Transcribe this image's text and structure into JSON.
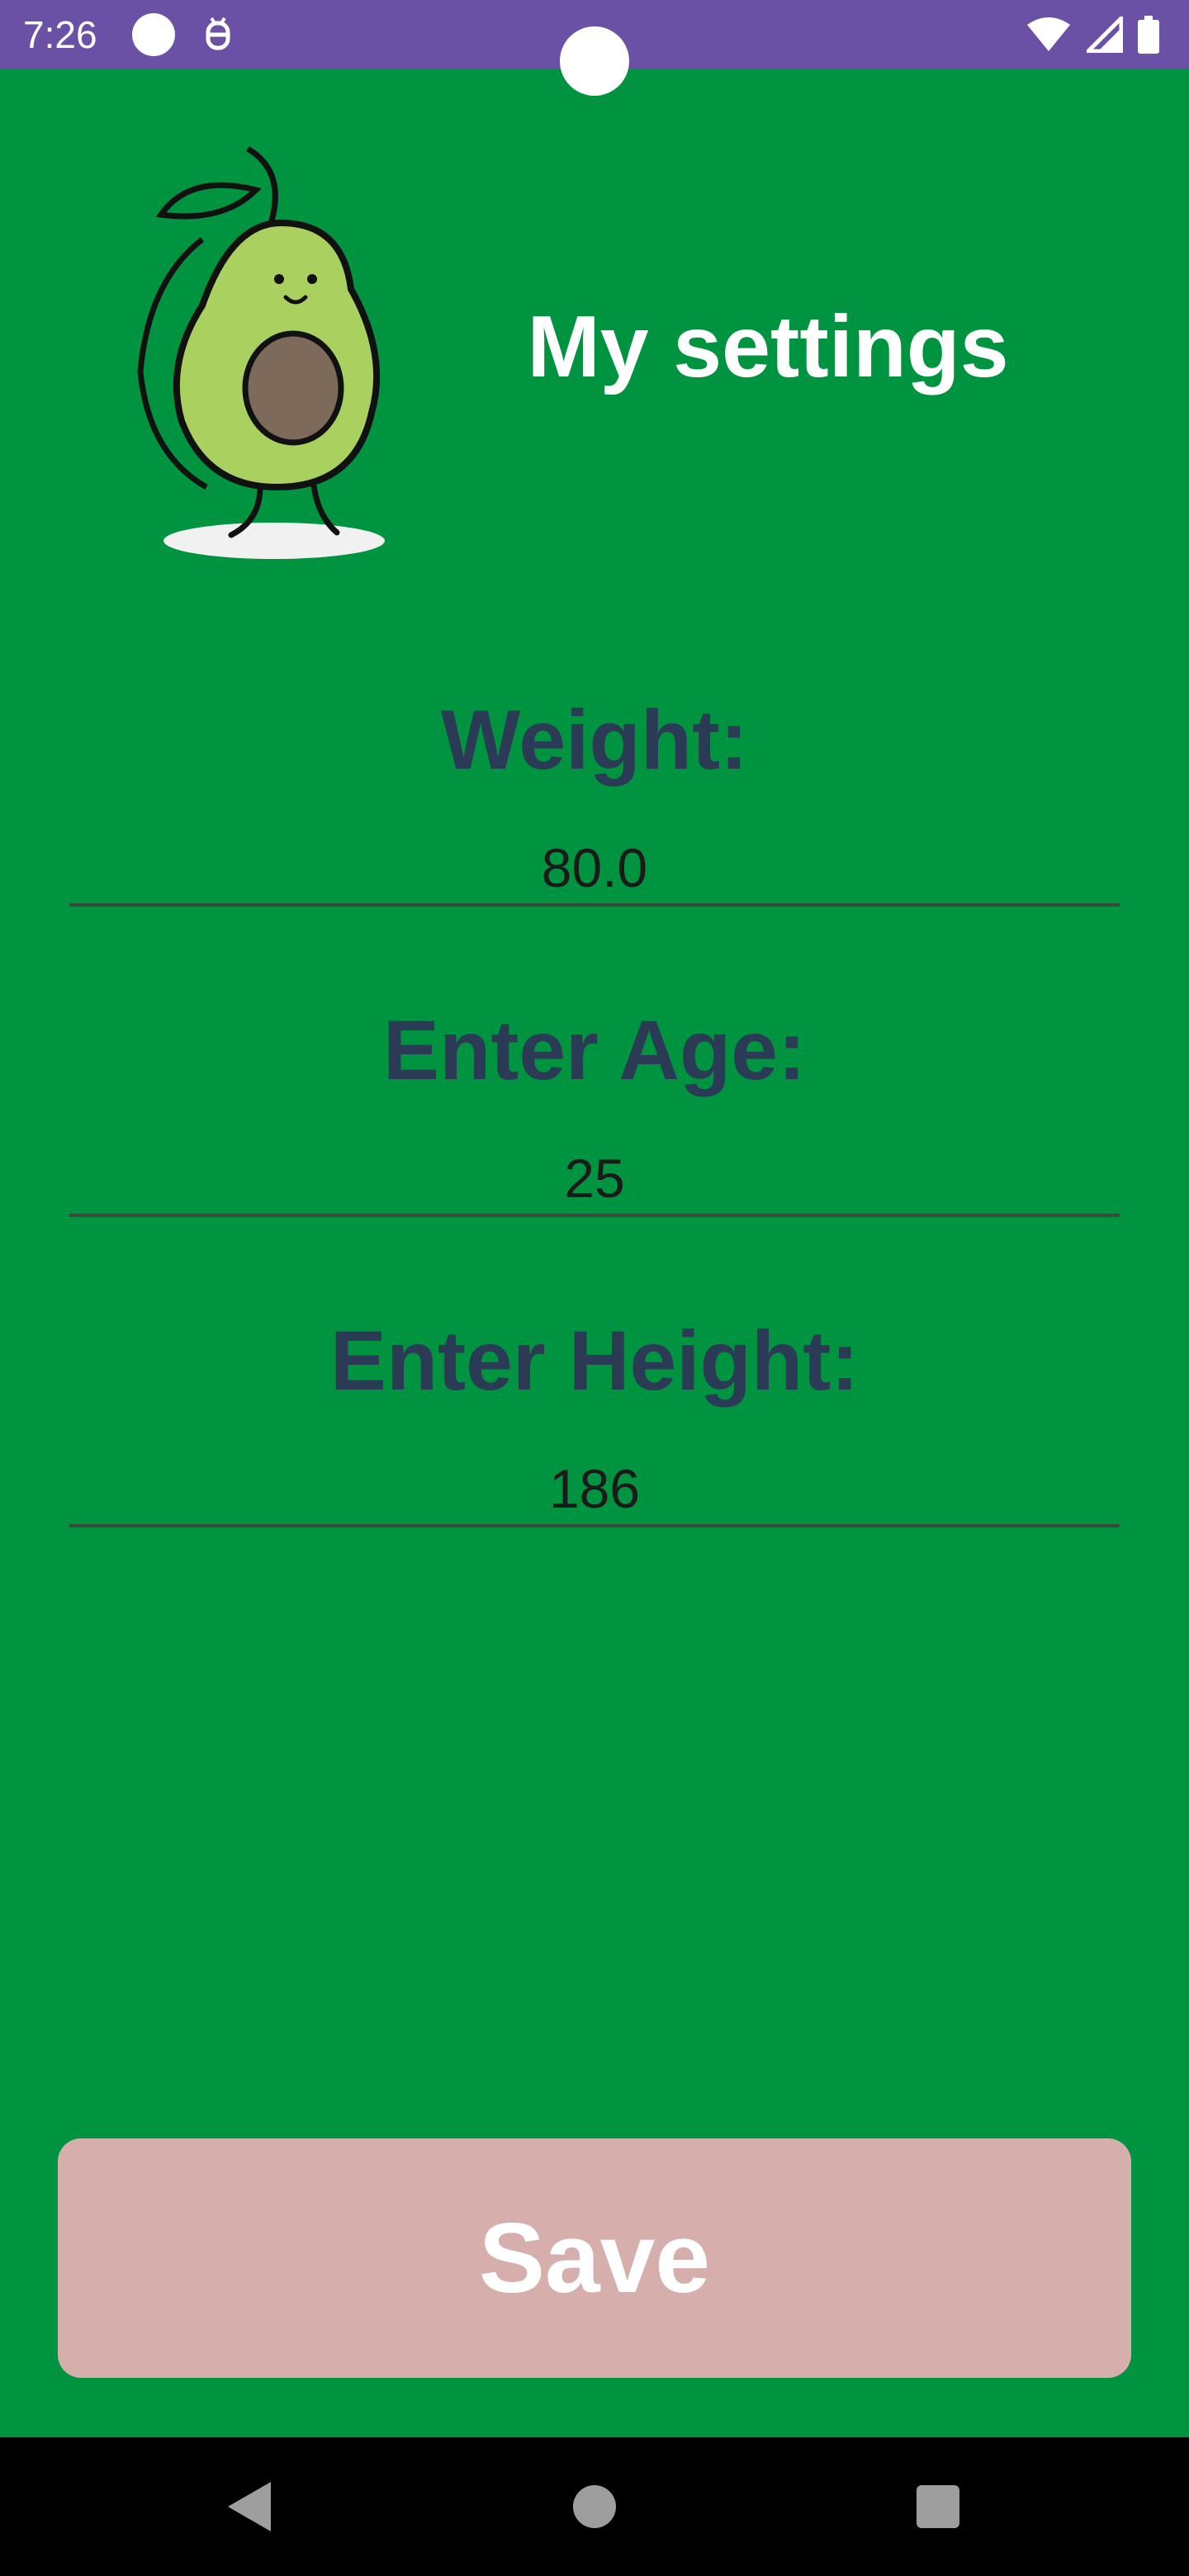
{
  "status_bar": {
    "time": "7:26",
    "icons": [
      "circle-icon",
      "usb-debug-icon",
      "wifi-icon",
      "signal-icon",
      "battery-icon"
    ],
    "color": "#6a51a6"
  },
  "header": {
    "title": "My settings",
    "illustration": "avocado-icon"
  },
  "form": {
    "weight": {
      "label": "Weight:",
      "value": "80.0"
    },
    "age": {
      "label": "Enter Age:",
      "value": "25"
    },
    "height": {
      "label": "Enter Height:",
      "value": "186"
    }
  },
  "actions": {
    "save_label": "Save",
    "save_color": "#d6aeac"
  },
  "nav_bar": {
    "icons": [
      "back-icon",
      "home-icon",
      "recents-icon"
    ]
  },
  "colors": {
    "background": "#009340",
    "label_text": "#2b3b55",
    "title_text": "#ffffff"
  }
}
